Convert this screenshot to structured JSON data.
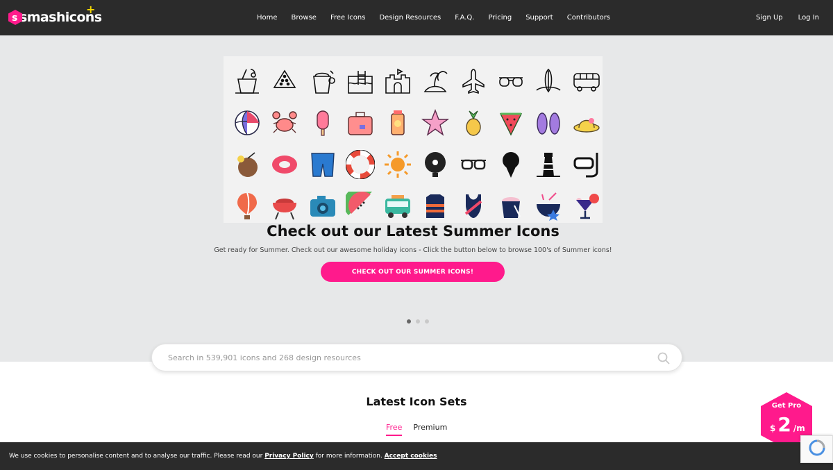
{
  "brand": {
    "name": "smashicons",
    "plus": "+",
    "accent": "#ff1a8c"
  },
  "nav": {
    "items": [
      "Home",
      "Browse",
      "Free Icons",
      "Design Resources",
      "F.A.Q.",
      "Pricing",
      "Support",
      "Contributors"
    ],
    "sign_up": "Sign Up",
    "log_in": "Log In"
  },
  "hero": {
    "title": "Check out our Latest Summer Icons",
    "subtitle": "Get ready for Summer. Check out our awesome holiday icons - Click the button below to browse 100's of Summer icons!",
    "cta": "CHECK OUT OUR SUMMER ICONS!",
    "slides": 3,
    "active_slide": 0
  },
  "icon_grid": {
    "rows": [
      [
        "cocktail-icon",
        "watermelon-icon",
        "sand-bucket-icon",
        "pool-ladder-icon",
        "sandcastle-icon",
        "island-icon",
        "airplane-icon",
        "sunglasses-icon",
        "surfboard-icon",
        "van-icon"
      ],
      [
        "beach-ball-icon",
        "crab-icon",
        "popsicle-icon",
        "suitcase-icon",
        "sunscreen-icon",
        "starfish-icon",
        "pineapple-icon",
        "watermelon-slice-icon",
        "flip-flops-icon",
        "sun-hat-icon"
      ],
      [
        "coconut-drink-icon",
        "swim-ring-icon",
        "swim-shorts-icon",
        "lifebuoy-icon",
        "sun-icon",
        "fan-icon",
        "sunglasses-icon",
        "ice-cream-icon",
        "lighthouse-icon",
        "snorkel-icon"
      ],
      [
        "hot-air-balloon-icon",
        "grill-icon",
        "camera-icon",
        "watermelon-icon",
        "camper-van-icon",
        "life-vest-icon",
        "swimsuit-icon",
        "sand-bucket-icon",
        "coconut-drink-icon",
        "cocktail-glass-icon"
      ]
    ]
  },
  "search": {
    "placeholder": "Search in  539,901  icons and 268 design resources"
  },
  "latest": {
    "title": "Latest Icon Sets",
    "tabs": [
      "Free",
      "Premium"
    ],
    "active_tab": "Free"
  },
  "pro": {
    "label": "Get Pro",
    "currency": "$",
    "price": "2",
    "period": "/m"
  },
  "cookie": {
    "text_before": "We use cookies to personalise content and to analyse our traffic. Please read our ",
    "policy_link": "Privacy Policy",
    "text_after": " for more information. ",
    "accept_link": "Accept cookies"
  }
}
